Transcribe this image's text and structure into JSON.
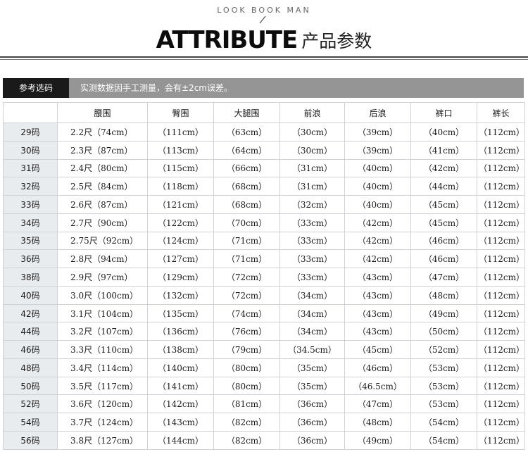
{
  "header": {
    "kicker": "LOOK BOOK MAN",
    "title_en": "ATTRIBUTE",
    "title_cn": "产品参数"
  },
  "banner": {
    "tab": "参考选码",
    "note": "实测数据因手工测量，会有±2cm误差。"
  },
  "table": {
    "columns": [
      "",
      "腰围",
      "臀围",
      "大腿围",
      "前浪",
      "后浪",
      "裤口",
      "裤长"
    ],
    "rows": [
      [
        "29码",
        "2.2尺（74cm）",
        "（111cm）",
        "（63cm）",
        "（30cm）",
        "（39cm）",
        "（40cm）",
        "（112cm）"
      ],
      [
        "30码",
        "2.3尺（87cm）",
        "（113cm）",
        "（64cm）",
        "（30cm）",
        "（39cm）",
        "（41cm）",
        "（112cm）"
      ],
      [
        "31码",
        "2.4尺（80cm）",
        "（115cm）",
        "（66cm）",
        "（31cm）",
        "（40cm）",
        "（42cm）",
        "（112cm）"
      ],
      [
        "32码",
        "2.5尺（84cm）",
        "（118cm）",
        "（68cm）",
        "（31cm）",
        "（40cm）",
        "（44cm）",
        "（112cm）"
      ],
      [
        "33码",
        "2.6尺（87cm）",
        "（121cm）",
        "（68cm）",
        "（32cm）",
        "（40cm）",
        "（45cm）",
        "（112cm）"
      ],
      [
        "34码",
        "2.7尺（90cm）",
        "（122cm）",
        "（70cm）",
        "（33cm）",
        "（42cm）",
        "（45cm）",
        "（112cm）"
      ],
      [
        "35码",
        "2.75尺（92cm）",
        "（124cm）",
        "（71cm）",
        "（33cm）",
        "（42cm）",
        "（46cm）",
        "（112cm）"
      ],
      [
        "36码",
        "2.8尺（94cm）",
        "（127cm）",
        "（71cm）",
        "（33cm）",
        "（42cm）",
        "（46cm）",
        "（112cm）"
      ],
      [
        "38码",
        "2.9尺（97cm）",
        "（129cm）",
        "（72cm）",
        "（33cm）",
        "（43cm）",
        "（47cm）",
        "（112cm）"
      ],
      [
        "40码",
        "3.0尺（100cm）",
        "（132cm）",
        "（72cm）",
        "（34cm）",
        "（43cm）",
        "（48cm）",
        "（112cm）"
      ],
      [
        "42码",
        "3.1尺（104cm）",
        "（135cm）",
        "（74cm）",
        "（34cm）",
        "（43cm）",
        "（49cm）",
        "（112cm）"
      ],
      [
        "44码",
        "3.2尺（107cm）",
        "（136cm）",
        "（76cm）",
        "（34cm）",
        "（43cm）",
        "（50cm）",
        "（112cm）"
      ],
      [
        "46码",
        "3.3尺（110cm）",
        "（138cm）",
        "（79cm）",
        "（34.5cm）",
        "（45cm）",
        "（52cm）",
        "（112cm）"
      ],
      [
        "48码",
        "3.4尺（114cm）",
        "（140cm）",
        "（80cm）",
        "（35cm）",
        "（46cm）",
        "（53cm）",
        "（112cm）"
      ],
      [
        "50码",
        "3.5尺（117cm）",
        "（141cm）",
        "（80cm）",
        "（35cm）",
        "（46.5cm）",
        "（53cm）",
        "（112cm）"
      ],
      [
        "52码",
        "3.6尺（120cm）",
        "（142cm）",
        "（81cm）",
        "（36cm）",
        "（47cm）",
        "（53cm）",
        "（112cm）"
      ],
      [
        "54码",
        "3.7尺（124cm）",
        "（143cm）",
        "（82cm）",
        "（36cm）",
        "（48cm）",
        "（54cm）",
        "（112cm）"
      ],
      [
        "56码",
        "3.8尺（127cm）",
        "（144cm）",
        "（82cm）",
        "（36cm）",
        "（49cm）",
        "（54cm）",
        "（112cm）"
      ]
    ]
  },
  "colors": {
    "banner_gray": "#959595",
    "banner_tab": "#1a1a1a",
    "size_cell_bg": "#e9ecef",
    "grid_line": "#cfd3d8"
  }
}
